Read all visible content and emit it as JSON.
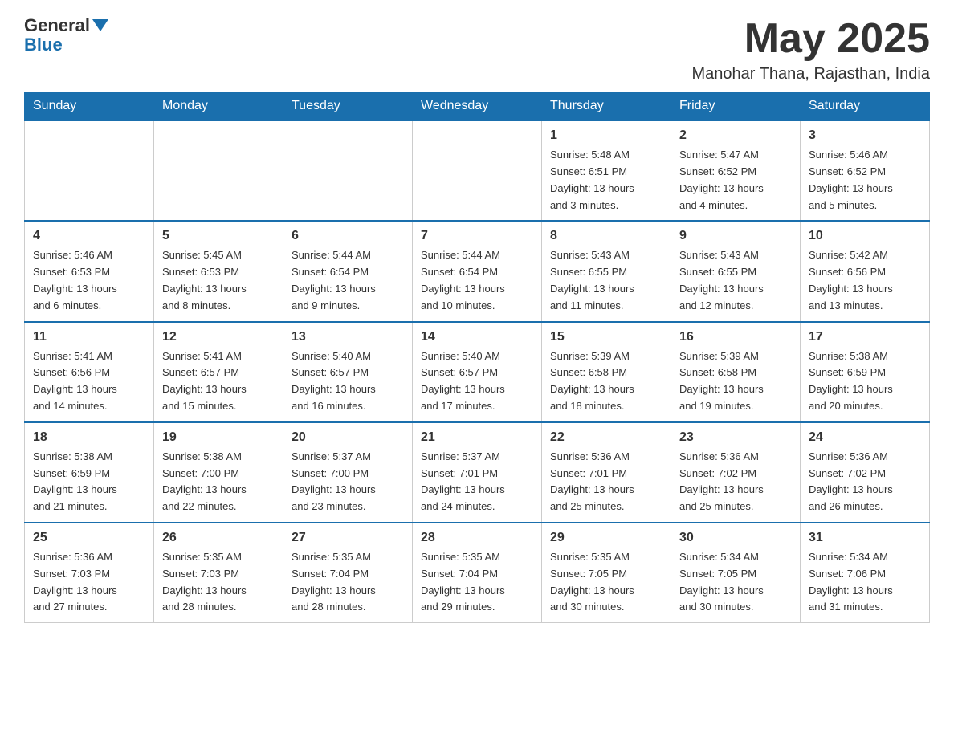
{
  "header": {
    "logo_line1": "General",
    "logo_line2": "Blue",
    "month_title": "May 2025",
    "location": "Manohar Thana, Rajasthan, India"
  },
  "days_of_week": [
    "Sunday",
    "Monday",
    "Tuesday",
    "Wednesday",
    "Thursday",
    "Friday",
    "Saturday"
  ],
  "weeks": [
    [
      {
        "day": "",
        "info": ""
      },
      {
        "day": "",
        "info": ""
      },
      {
        "day": "",
        "info": ""
      },
      {
        "day": "",
        "info": ""
      },
      {
        "day": "1",
        "info": "Sunrise: 5:48 AM\nSunset: 6:51 PM\nDaylight: 13 hours\nand 3 minutes."
      },
      {
        "day": "2",
        "info": "Sunrise: 5:47 AM\nSunset: 6:52 PM\nDaylight: 13 hours\nand 4 minutes."
      },
      {
        "day": "3",
        "info": "Sunrise: 5:46 AM\nSunset: 6:52 PM\nDaylight: 13 hours\nand 5 minutes."
      }
    ],
    [
      {
        "day": "4",
        "info": "Sunrise: 5:46 AM\nSunset: 6:53 PM\nDaylight: 13 hours\nand 6 minutes."
      },
      {
        "day": "5",
        "info": "Sunrise: 5:45 AM\nSunset: 6:53 PM\nDaylight: 13 hours\nand 8 minutes."
      },
      {
        "day": "6",
        "info": "Sunrise: 5:44 AM\nSunset: 6:54 PM\nDaylight: 13 hours\nand 9 minutes."
      },
      {
        "day": "7",
        "info": "Sunrise: 5:44 AM\nSunset: 6:54 PM\nDaylight: 13 hours\nand 10 minutes."
      },
      {
        "day": "8",
        "info": "Sunrise: 5:43 AM\nSunset: 6:55 PM\nDaylight: 13 hours\nand 11 minutes."
      },
      {
        "day": "9",
        "info": "Sunrise: 5:43 AM\nSunset: 6:55 PM\nDaylight: 13 hours\nand 12 minutes."
      },
      {
        "day": "10",
        "info": "Sunrise: 5:42 AM\nSunset: 6:56 PM\nDaylight: 13 hours\nand 13 minutes."
      }
    ],
    [
      {
        "day": "11",
        "info": "Sunrise: 5:41 AM\nSunset: 6:56 PM\nDaylight: 13 hours\nand 14 minutes."
      },
      {
        "day": "12",
        "info": "Sunrise: 5:41 AM\nSunset: 6:57 PM\nDaylight: 13 hours\nand 15 minutes."
      },
      {
        "day": "13",
        "info": "Sunrise: 5:40 AM\nSunset: 6:57 PM\nDaylight: 13 hours\nand 16 minutes."
      },
      {
        "day": "14",
        "info": "Sunrise: 5:40 AM\nSunset: 6:57 PM\nDaylight: 13 hours\nand 17 minutes."
      },
      {
        "day": "15",
        "info": "Sunrise: 5:39 AM\nSunset: 6:58 PM\nDaylight: 13 hours\nand 18 minutes."
      },
      {
        "day": "16",
        "info": "Sunrise: 5:39 AM\nSunset: 6:58 PM\nDaylight: 13 hours\nand 19 minutes."
      },
      {
        "day": "17",
        "info": "Sunrise: 5:38 AM\nSunset: 6:59 PM\nDaylight: 13 hours\nand 20 minutes."
      }
    ],
    [
      {
        "day": "18",
        "info": "Sunrise: 5:38 AM\nSunset: 6:59 PM\nDaylight: 13 hours\nand 21 minutes."
      },
      {
        "day": "19",
        "info": "Sunrise: 5:38 AM\nSunset: 7:00 PM\nDaylight: 13 hours\nand 22 minutes."
      },
      {
        "day": "20",
        "info": "Sunrise: 5:37 AM\nSunset: 7:00 PM\nDaylight: 13 hours\nand 23 minutes."
      },
      {
        "day": "21",
        "info": "Sunrise: 5:37 AM\nSunset: 7:01 PM\nDaylight: 13 hours\nand 24 minutes."
      },
      {
        "day": "22",
        "info": "Sunrise: 5:36 AM\nSunset: 7:01 PM\nDaylight: 13 hours\nand 25 minutes."
      },
      {
        "day": "23",
        "info": "Sunrise: 5:36 AM\nSunset: 7:02 PM\nDaylight: 13 hours\nand 25 minutes."
      },
      {
        "day": "24",
        "info": "Sunrise: 5:36 AM\nSunset: 7:02 PM\nDaylight: 13 hours\nand 26 minutes."
      }
    ],
    [
      {
        "day": "25",
        "info": "Sunrise: 5:36 AM\nSunset: 7:03 PM\nDaylight: 13 hours\nand 27 minutes."
      },
      {
        "day": "26",
        "info": "Sunrise: 5:35 AM\nSunset: 7:03 PM\nDaylight: 13 hours\nand 28 minutes."
      },
      {
        "day": "27",
        "info": "Sunrise: 5:35 AM\nSunset: 7:04 PM\nDaylight: 13 hours\nand 28 minutes."
      },
      {
        "day": "28",
        "info": "Sunrise: 5:35 AM\nSunset: 7:04 PM\nDaylight: 13 hours\nand 29 minutes."
      },
      {
        "day": "29",
        "info": "Sunrise: 5:35 AM\nSunset: 7:05 PM\nDaylight: 13 hours\nand 30 minutes."
      },
      {
        "day": "30",
        "info": "Sunrise: 5:34 AM\nSunset: 7:05 PM\nDaylight: 13 hours\nand 30 minutes."
      },
      {
        "day": "31",
        "info": "Sunrise: 5:34 AM\nSunset: 7:06 PM\nDaylight: 13 hours\nand 31 minutes."
      }
    ]
  ]
}
